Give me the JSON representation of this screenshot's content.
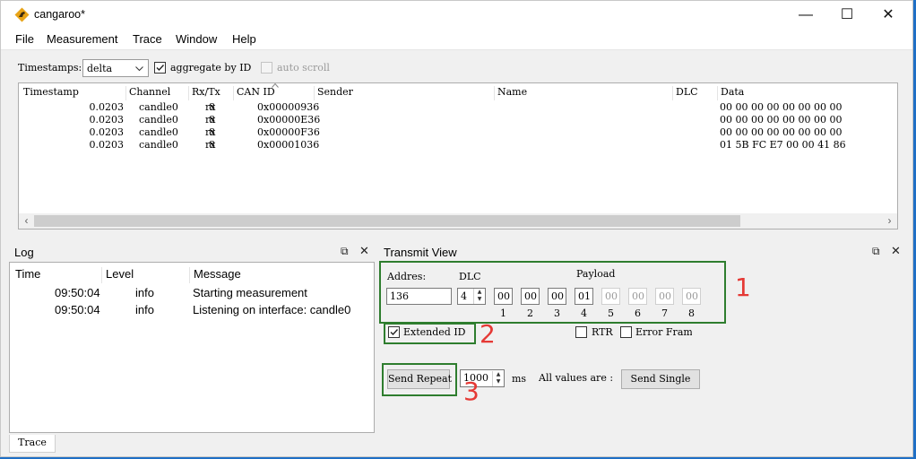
{
  "window": {
    "title": "cangaroo*",
    "minimize": "—",
    "maximize": "☐",
    "close": "✕"
  },
  "menu": [
    "File",
    "Measurement",
    "Trace",
    "Window",
    "Help"
  ],
  "toolbar": {
    "timestamps_label": "Timestamps:",
    "timestamps_value": "delta",
    "aggregate_label": "aggregate by ID",
    "aggregate_checked": true,
    "autoscroll_label": "auto scroll",
    "autoscroll_checked": false
  },
  "trace": {
    "columns": [
      "Timestamp",
      "Channel",
      "Rx/Tx",
      "CAN ID",
      "Sender",
      "Name",
      "DLC",
      "Data"
    ],
    "rows": [
      {
        "timestamp": "0.0203",
        "channel": "candle0",
        "rxtx": "rx",
        "can_id": "0x00000936",
        "sender": "",
        "name": "",
        "dlc": "8",
        "data": "00 00 00 00 00 00 00 00"
      },
      {
        "timestamp": "0.0203",
        "channel": "candle0",
        "rxtx": "rx",
        "can_id": "0x00000E36",
        "sender": "",
        "name": "",
        "dlc": "8",
        "data": "00 00 00 00 00 00 00 00"
      },
      {
        "timestamp": "0.0203",
        "channel": "candle0",
        "rxtx": "rx",
        "can_id": "0x00000F36",
        "sender": "",
        "name": "",
        "dlc": "8",
        "data": "00 00 00 00 00 00 00 00"
      },
      {
        "timestamp": "0.0203",
        "channel": "candle0",
        "rxtx": "rx",
        "can_id": "0x00001036",
        "sender": "",
        "name": "",
        "dlc": "8",
        "data": "01 5B FC E7 00 00 41 86"
      }
    ]
  },
  "log": {
    "title": "Log",
    "columns": [
      "Time",
      "Level",
      "Message"
    ],
    "rows": [
      {
        "time": "09:50:04",
        "level": "info",
        "message": "Starting measurement"
      },
      {
        "time": "09:50:04",
        "level": "info",
        "message": "Listening on interface: candle0"
      }
    ]
  },
  "transmit": {
    "title": "Transmit View",
    "address_label": "Addres:",
    "address_value": "136",
    "dlc_label": "DLC",
    "dlc_value": "4",
    "payload_label": "Payload",
    "payload": [
      {
        "index": "1",
        "value": "00",
        "enabled": true
      },
      {
        "index": "2",
        "value": "00",
        "enabled": true
      },
      {
        "index": "3",
        "value": "00",
        "enabled": true
      },
      {
        "index": "4",
        "value": "01",
        "enabled": true
      },
      {
        "index": "5",
        "value": "00",
        "enabled": false
      },
      {
        "index": "6",
        "value": "00",
        "enabled": false
      },
      {
        "index": "7",
        "value": "00",
        "enabled": false
      },
      {
        "index": "8",
        "value": "00",
        "enabled": false
      }
    ],
    "extended_id_label": "Extended ID",
    "extended_id_checked": true,
    "rtr_label": "RTR",
    "error_frame_label": "Error Fram",
    "send_repeat_label": "Send Repeat",
    "interval_value": "1000",
    "ms_label": "ms",
    "all_values_label": "All values are :",
    "send_single_label": "Send Single"
  },
  "annotations": [
    "1",
    "2",
    "3"
  ],
  "bottom_tab": "Trace",
  "colors": {
    "annotation_box": "#2e7d2e",
    "annotation_number": "#e53935",
    "desktop": "#1f6fc5"
  }
}
